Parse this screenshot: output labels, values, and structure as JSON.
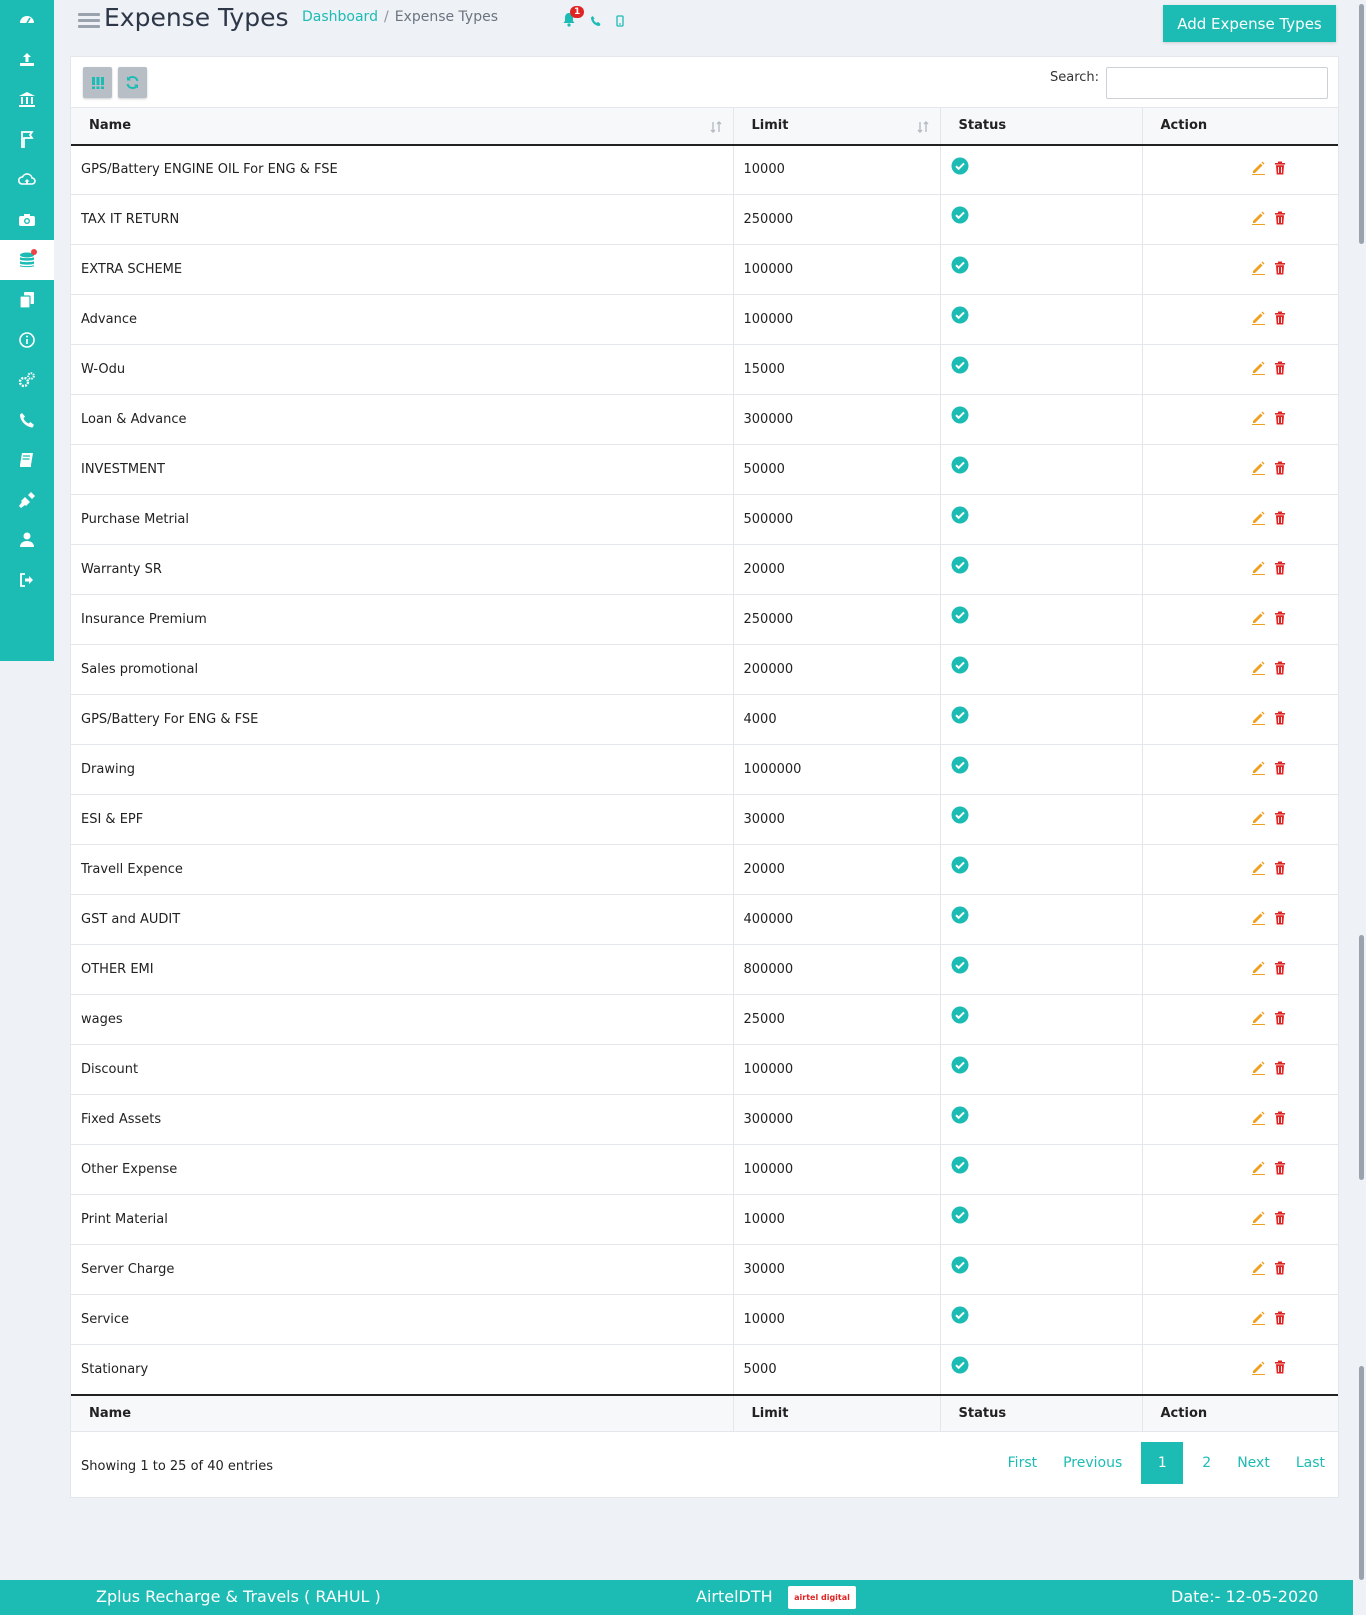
{
  "sidebar": {
    "items": [
      {
        "icon": "dashboard-icon",
        "active": false
      },
      {
        "icon": "upload-icon",
        "active": false
      },
      {
        "icon": "bank-icon",
        "active": false
      },
      {
        "icon": "flag-icon",
        "active": false
      },
      {
        "icon": "cloud-upload-icon",
        "active": false
      },
      {
        "icon": "camera-icon",
        "active": false
      },
      {
        "icon": "database-icon",
        "active": true
      },
      {
        "icon": "copy-icon",
        "active": false
      },
      {
        "icon": "info-icon",
        "active": false
      },
      {
        "icon": "settings-icon",
        "active": false
      },
      {
        "icon": "phone-icon",
        "active": false
      },
      {
        "icon": "book-icon",
        "active": false
      },
      {
        "icon": "plug-icon",
        "active": false
      },
      {
        "icon": "user-icon",
        "active": false
      },
      {
        "icon": "logout-icon",
        "active": false
      }
    ]
  },
  "header": {
    "title": "Expense Types",
    "breadcrumb": {
      "home": "Dashboard",
      "separator": "/",
      "current": "Expense Types"
    },
    "notification_count": "1",
    "add_button": "Add Expense Types"
  },
  "toolbar": {
    "search_label": "Search:",
    "search_value": ""
  },
  "table": {
    "columns": {
      "name": "Name",
      "limit": "Limit",
      "status": "Status",
      "action": "Action"
    },
    "rows": [
      {
        "name": "GPS/Battery ENGINE OIL For ENG & FSE",
        "limit": "10000"
      },
      {
        "name": "TAX IT RETURN",
        "limit": "250000"
      },
      {
        "name": "EXTRA SCHEME",
        "limit": "100000"
      },
      {
        "name": "Advance",
        "limit": "100000"
      },
      {
        "name": "W-Odu",
        "limit": "15000"
      },
      {
        "name": "Loan & Advance",
        "limit": "300000"
      },
      {
        "name": "INVESTMENT",
        "limit": "50000"
      },
      {
        "name": "Purchase Metrial",
        "limit": "500000"
      },
      {
        "name": "Warranty SR",
        "limit": "20000"
      },
      {
        "name": "Insurance Premium",
        "limit": "250000"
      },
      {
        "name": "Sales promotional",
        "limit": "200000"
      },
      {
        "name": "GPS/Battery For ENG & FSE",
        "limit": "4000"
      },
      {
        "name": "Drawing",
        "limit": "1000000"
      },
      {
        "name": "ESI & EPF",
        "limit": "30000"
      },
      {
        "name": "Travell Expence",
        "limit": "20000"
      },
      {
        "name": "GST and AUDIT",
        "limit": "400000"
      },
      {
        "name": "OTHER EMI",
        "limit": "800000"
      },
      {
        "name": "wages",
        "limit": "25000"
      },
      {
        "name": "Discount",
        "limit": "100000"
      },
      {
        "name": "Fixed Assets",
        "limit": "300000"
      },
      {
        "name": "Other Expense",
        "limit": "100000"
      },
      {
        "name": "Print Material",
        "limit": "10000"
      },
      {
        "name": "Server Charge",
        "limit": "30000"
      },
      {
        "name": "Service",
        "limit": "10000"
      },
      {
        "name": "Stationary",
        "limit": "5000"
      }
    ]
  },
  "pagination": {
    "info": "Showing 1 to 25 of 40 entries",
    "first": "First",
    "previous": "Previous",
    "pages": [
      "1",
      "2"
    ],
    "next": "Next",
    "last": "Last"
  },
  "footer": {
    "company": "Zplus Recharge & Travels ( RAHUL )",
    "service": "AirtelDTH",
    "logo_text": "airtel digital",
    "date": "Date:- 12-05-2020"
  },
  "colors": {
    "accent": "#1cbcb4",
    "edit": "#f0a020",
    "delete": "#e02424"
  }
}
